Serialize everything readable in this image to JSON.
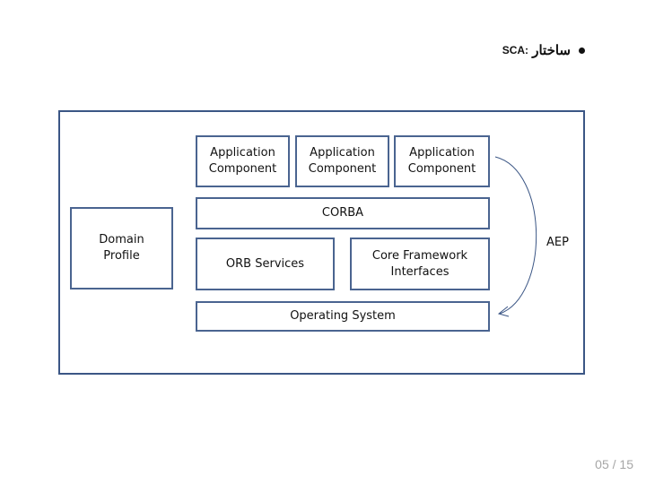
{
  "slide": {
    "title_persian": "ساختار",
    "title_acronym": "SCA:",
    "page_number": "05 / 15"
  },
  "diagram": {
    "colors": {
      "border": "#3b5685",
      "arrow": "#3b5685",
      "text": "#111111",
      "page_number": "#a6a6a6"
    },
    "domain_profile": "Domain\nProfile",
    "application_components": [
      "Application\nComponent",
      "Application\nComponent",
      "Application\nComponent"
    ],
    "corba": "CORBA",
    "orb_services": "ORB Services",
    "core_framework": "Core Framework\nInterfaces",
    "operating_system": "Operating System",
    "aep_label": "AEP"
  }
}
